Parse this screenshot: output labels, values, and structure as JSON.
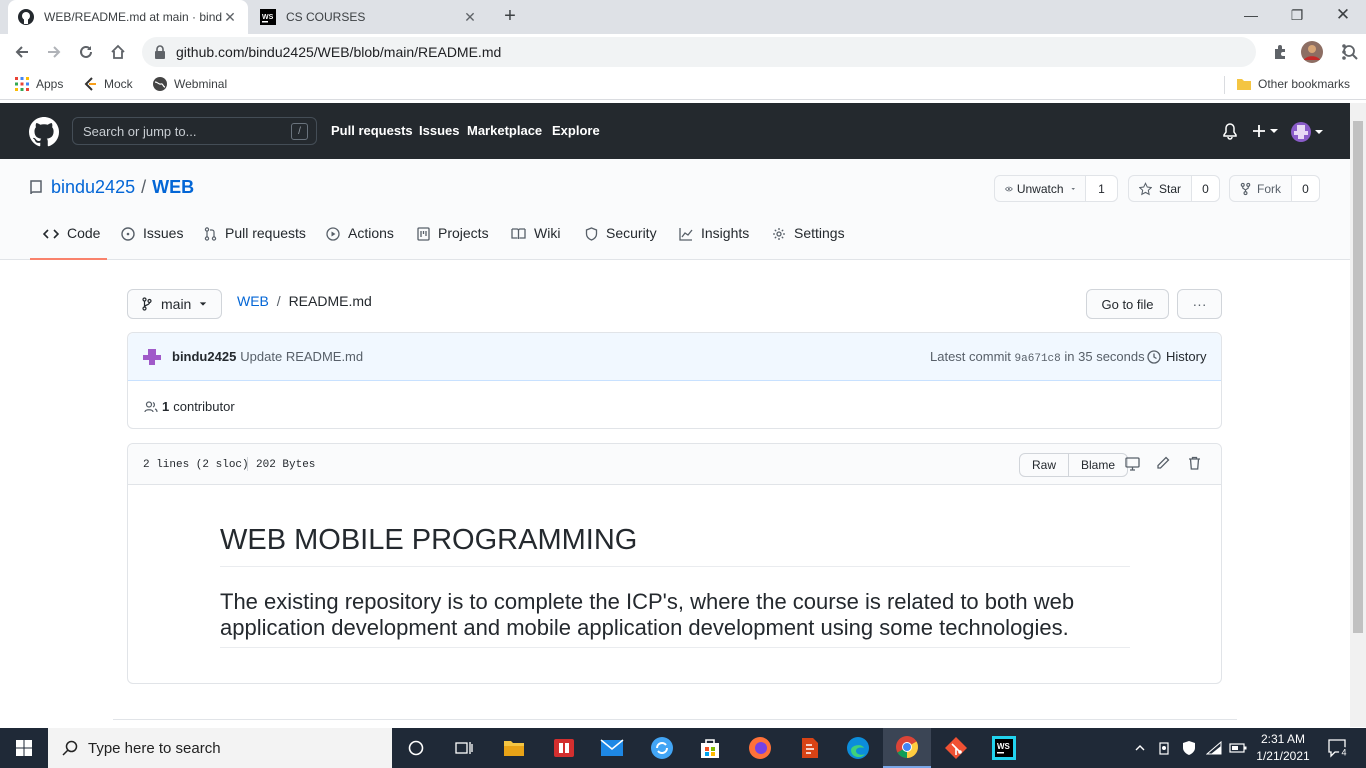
{
  "browser": {
    "tabs": [
      {
        "title": "WEB/README.md at main · bindu2425",
        "active": true
      },
      {
        "title": "CS COURSES",
        "active": false
      }
    ],
    "url": "github.com/bindu2425/WEB/blob/main/README.md",
    "bookmarks": [
      "Apps",
      "Mock",
      "Webminal"
    ],
    "other_bookmarks": "Other bookmarks"
  },
  "github": {
    "search_placeholder": "Search or jump to...",
    "search_shortcut": "/",
    "nav": [
      "Pull requests",
      "Issues",
      "Marketplace",
      "Explore"
    ]
  },
  "repo": {
    "owner": "bindu2425",
    "separator": "/",
    "name": "WEB",
    "unwatch_label": "Unwatch",
    "watch_count": "1",
    "star_label": "Star",
    "star_count": "0",
    "fork_label": "Fork",
    "fork_count": "0",
    "tabs": [
      "Code",
      "Issues",
      "Pull requests",
      "Actions",
      "Projects",
      "Wiki",
      "Security",
      "Insights",
      "Settings"
    ]
  },
  "file": {
    "branch": "main",
    "breadcrumb_repo": "WEB",
    "breadcrumb_sep": "/",
    "filename": "README.md",
    "goto_label": "Go to file",
    "more_label": "···",
    "commit_author": "bindu2425",
    "commit_message": "Update README.md",
    "latest_commit_label": "Latest commit",
    "commit_sha": "9a671c8",
    "commit_time": "in 35 seconds",
    "history_label": "History",
    "contributor_count": "1",
    "contributor_label": "contributor",
    "lines_info": "2 lines (2 sloc)",
    "size_info": "202 Bytes",
    "raw_label": "Raw",
    "blame_label": "Blame"
  },
  "readme": {
    "heading": "WEB MOBILE PROGRAMMING",
    "subheading": "The existing repository is to complete the ICP's, where the course is related to both web application development and mobile application development using some technologies."
  },
  "taskbar": {
    "search_placeholder": "Type here to search",
    "time": "2:31 AM",
    "date": "1/21/2021",
    "notification_count": "4"
  },
  "colors": {
    "github_header": "#24292e",
    "link_blue": "#0366d6",
    "active_tab_underline": "#f9826c",
    "taskbar": "#1f2937"
  }
}
